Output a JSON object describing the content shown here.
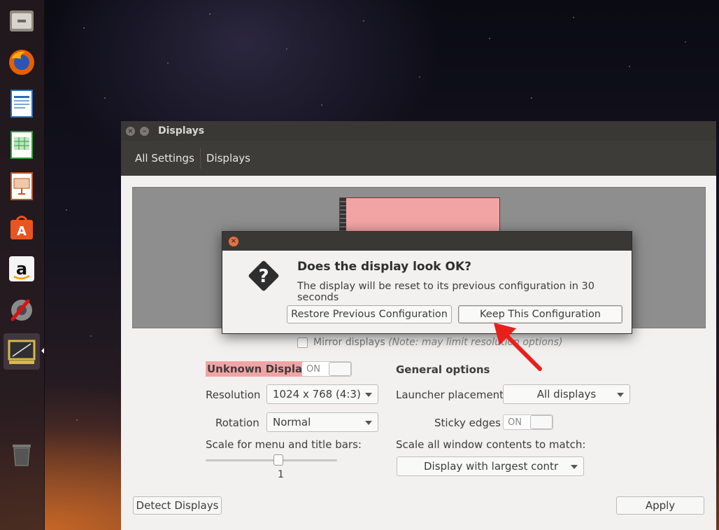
{
  "launcher": {
    "items": [
      {
        "name": "files-icon"
      },
      {
        "name": "firefox-icon"
      },
      {
        "name": "libreoffice-writer-icon"
      },
      {
        "name": "libreoffice-calc-icon"
      },
      {
        "name": "libreoffice-impress-icon"
      },
      {
        "name": "ubuntu-software-icon"
      },
      {
        "name": "amazon-icon"
      },
      {
        "name": "system-settings-icon"
      },
      {
        "name": "displays-icon"
      },
      {
        "name": "trash-icon"
      }
    ]
  },
  "window": {
    "title": "Displays",
    "breadcrumb": [
      "All Settings",
      "Displays"
    ]
  },
  "mirror": {
    "label": "Mirror displays",
    "note": "(Note: may limit resolution options)",
    "checked": false
  },
  "display": {
    "name": "Unknown Display",
    "toggle": "ON",
    "resolution_label": "Resolution",
    "resolution_value": "1024 x 768 (4:3)",
    "rotation_label": "Rotation",
    "rotation_value": "Normal",
    "scale_label": "Scale for menu and title bars:",
    "scale_value": "1",
    "scale_fraction": 0.55
  },
  "general": {
    "heading": "General options",
    "launcher_label": "Launcher placement",
    "launcher_value": "All displays",
    "sticky_label": "Sticky edges",
    "sticky_toggle": "ON",
    "scale_all_label": "Scale all window contents to match:",
    "scale_all_value": "Display with largest contr"
  },
  "buttons": {
    "detect": "Detect Displays",
    "apply": "Apply"
  },
  "dialog": {
    "heading": "Does the display look OK?",
    "message": "The display will be reset to its previous configuration in 30 seconds",
    "restore": "Restore Previous Configuration",
    "keep": "Keep This Configuration"
  },
  "colors": {
    "accent_red": "#e8201c",
    "monitor_pink": "#f2a4a4",
    "close_orange": "#e8703f"
  }
}
